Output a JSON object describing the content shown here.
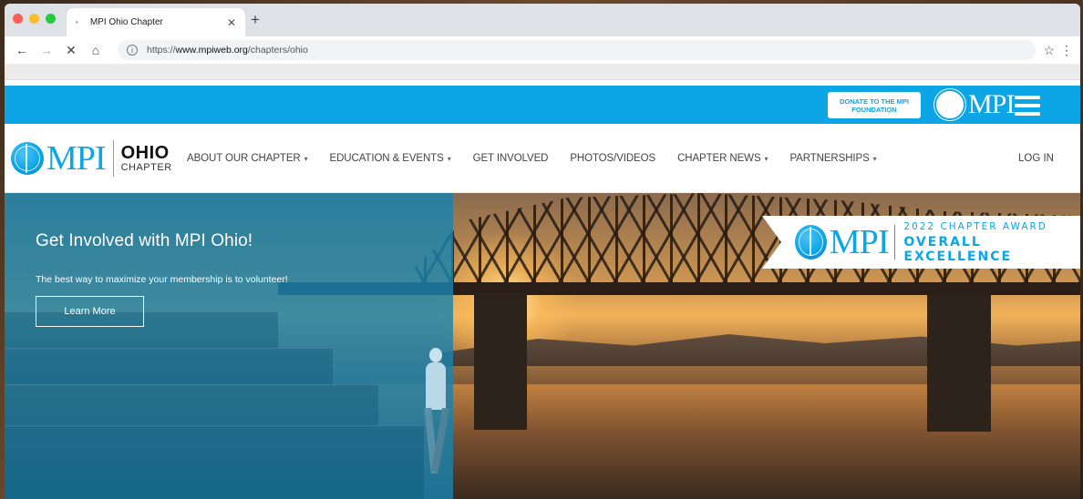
{
  "browser": {
    "tab_title": "MPI Ohio Chapter",
    "url_prefix": "https://",
    "url_domain": "www.mpiweb.org",
    "url_path": "/chapters/ohio"
  },
  "site_top": {
    "donate_label": "DONATE TO THE MPI FOUNDATION",
    "logo_text": "MPI"
  },
  "nav": {
    "logo_text": "MPI",
    "ohio_label": "OHIO",
    "chapter_label": "CHAPTER",
    "items": [
      {
        "label": "ABOUT OUR CHAPTER",
        "has_caret": true
      },
      {
        "label": "EDUCATION & EVENTS",
        "has_caret": true
      },
      {
        "label": "GET INVOLVED",
        "has_caret": false
      },
      {
        "label": "PHOTOS/VIDEOS",
        "has_caret": false
      },
      {
        "label": "CHAPTER NEWS",
        "has_caret": true
      },
      {
        "label": "PARTNERSHIPS",
        "has_caret": true
      }
    ],
    "login_label": "LOG IN"
  },
  "hero": {
    "title": "Get Involved with MPI Ohio!",
    "subtitle": "The best way to maximize your membership is to volunteer!",
    "button_label": "Learn More"
  },
  "award": {
    "logo_text": "MPI",
    "line1": "2022 CHAPTER AWARD",
    "line2": "OVERALL EXCELLENCE"
  },
  "colors": {
    "brand_blue": "#0ca6e6",
    "hero_overlay": "#1882af"
  },
  "icons": {
    "back": "arrow-left-icon",
    "forward": "arrow-right-icon",
    "stop": "close-icon",
    "home": "home-icon",
    "info": "info-icon",
    "bookmark": "star-icon",
    "menu": "hamburger-icon"
  }
}
